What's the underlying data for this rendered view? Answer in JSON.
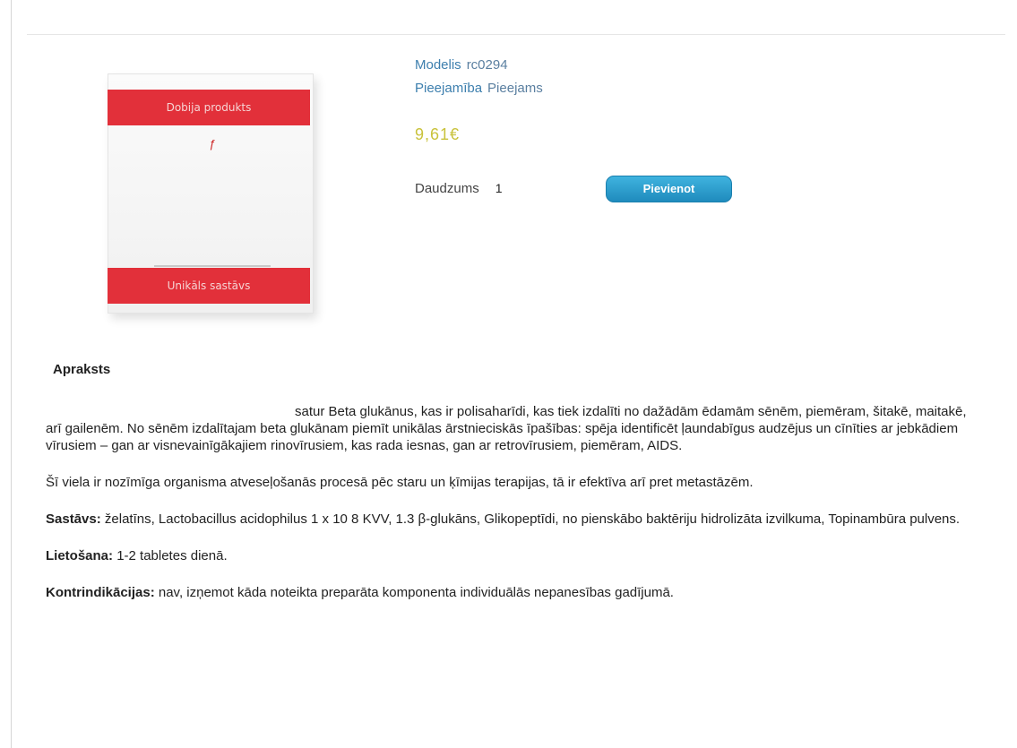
{
  "product": {
    "image_box": {
      "band_top": "Dobija produkts",
      "band_bottom": "Unikāls sastāvs"
    },
    "model_label": "Modelis",
    "model_value": "rc0294",
    "availability_label": "Pieejamība",
    "availability_value": "Pieejams",
    "price": "9,61€",
    "quantity_label": "Daudzums",
    "quantity_value": "1",
    "add_button_label": "Pievienot"
  },
  "description": {
    "title": "Apraksts",
    "intro": "satur Beta glukānus, kas ir polisaharīdi, kas tiek izdalīti no dažādām ēdamām sēnēm, piemēram, šitakē, maitakē, arī gailenēm. No sēnēm izdalītajam beta glukānam piemīt unikālas ārstnieciskās īpašības: spēja identificēt ļaundabīgus audzējus un cīnīties ar jebkādiem vīrusiem – gan ar visnevainīgākajiem rinovīrusiem, kas rada iesnas, gan ar retrovīrusiem, piemēram, AIDS.",
    "paragraph2": "Šī viela ir nozīmīga organisma atveseļošanās procesā pēc staru un ķīmijas terapijas, tā ir efektīva arī pret metastāzēm.",
    "composition_label": "Sastāvs:",
    "composition_text": "želatīns, Lactobacillus acidophilus 1 x 10 8 KVV, 1.3 β-glukāns, Glikopeptīdi, no pienskābo baktēriju hidrolizāta izvilkuma, Topinambūra pulvens.",
    "usage_label": "Lietošana:",
    "usage_text": "1-2 tabletes dienā.",
    "contra_label": "Kontrindikācijas:",
    "contra_text": "nav, izņemot kāda noteikta preparāta komponenta individuālās nepanesības gadījumā."
  }
}
